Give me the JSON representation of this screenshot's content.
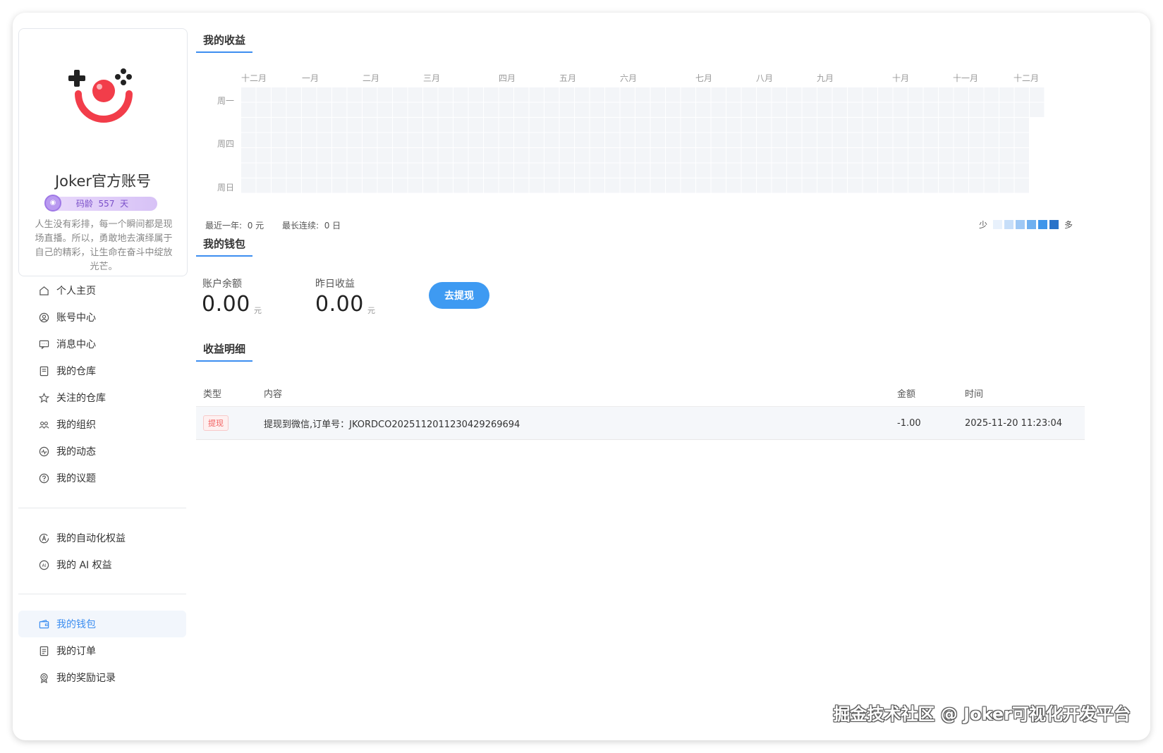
{
  "profile": {
    "name": "Joker官方账号",
    "age_label": "码龄",
    "age_value": "557",
    "age_unit": "天",
    "bio": "人生没有彩排，每一个瞬间都是现场直播。所以，勇敢地去演绎属于自己的精彩，让生命在奋斗中绽放光芒。"
  },
  "menu_group1": [
    {
      "label": "个人主页",
      "icon": "home-icon"
    },
    {
      "label": "账号中心",
      "icon": "user-circle-icon"
    },
    {
      "label": "消息中心",
      "icon": "message-icon"
    },
    {
      "label": "我的仓库",
      "icon": "repo-icon"
    },
    {
      "label": "关注的仓库",
      "icon": "star-icon"
    },
    {
      "label": "我的组织",
      "icon": "org-icon"
    },
    {
      "label": "我的动态",
      "icon": "activity-icon"
    },
    {
      "label": "我的议题",
      "icon": "question-icon"
    }
  ],
  "menu_group2": [
    {
      "label": "我的自动化权益",
      "icon": "automation-icon"
    },
    {
      "label": "我的 AI 权益",
      "icon": "ai-icon"
    }
  ],
  "menu_group3": [
    {
      "label": "我的钱包",
      "icon": "wallet-icon",
      "active": true
    },
    {
      "label": "我的订单",
      "icon": "order-icon"
    },
    {
      "label": "我的奖励记录",
      "icon": "reward-icon"
    }
  ],
  "earnings": {
    "title": "我的收益",
    "months": [
      "十二月",
      "一月",
      "二月",
      "三月",
      "四月",
      "五月",
      "六月",
      "七月",
      "八月",
      "九月",
      "十月",
      "十一月",
      "十二月"
    ],
    "days": [
      "周一",
      "周四",
      "周日"
    ],
    "last_year_label": "最近一年:",
    "last_year_value": "0 元",
    "streak_label": "最长连续:",
    "streak_value": "0 日",
    "legend_less": "少",
    "legend_more": "多",
    "legend_colors": [
      "#e8f1fc",
      "#c6def9",
      "#9ec8f5",
      "#6fb0f0",
      "#3e95ea",
      "#2a73c9"
    ]
  },
  "wallet": {
    "title": "我的钱包",
    "balance_label": "账户余额",
    "balance_value": "0.00",
    "balance_unit": "元",
    "yesterday_label": "昨日收益",
    "yesterday_value": "0.00",
    "yesterday_unit": "元",
    "withdraw_button": "去提现"
  },
  "details": {
    "title": "收益明细",
    "headers": {
      "type": "类型",
      "content": "内容",
      "amount": "金额",
      "time": "时间"
    },
    "rows": [
      {
        "type": "提现",
        "content": "提现到微信,订单号：JKORDCO2025112011230429269694",
        "amount": "-1.00",
        "time": "2025-11-20 11:23:04"
      }
    ]
  },
  "watermark": "掘金技术社区 @ Joker可视化开发平台",
  "accent_color": "#3d8ef0"
}
